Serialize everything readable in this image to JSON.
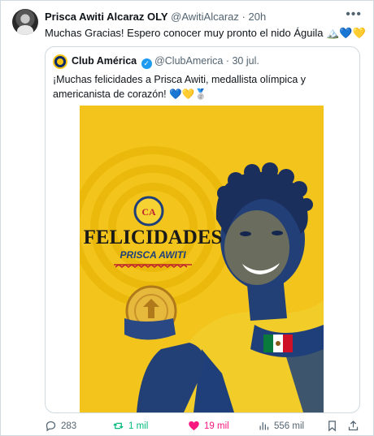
{
  "tweet": {
    "author_name": "Prisca Awiti Alcaraz OLY",
    "handle": "@AwitiAlcaraz",
    "time": "20h",
    "text": "Muchas Gracias! Espero conocer muy pronto el nido Águila",
    "more_icon": "more-horizontal-icon"
  },
  "quoted": {
    "author_name": "Club América",
    "handle": "@ClubAmerica",
    "date": "30 jul.",
    "text": "¡Muchas felicidades a Prisca Awiti, medallista olímpica y americanista de corazón!",
    "media": {
      "headline": "FELICIDADES",
      "subtitle": "PRISCA AWITI",
      "crest_text": "CA"
    }
  },
  "actions": {
    "replies": "283",
    "reposts": "1 mil",
    "likes": "19 mil",
    "views": "556 mil"
  },
  "colors": {
    "accent": "#1d9bf0",
    "like": "#f91880",
    "repost": "#00ba7c",
    "poster_yellow": "#f3c51c",
    "poster_blue": "#1f3f7a"
  }
}
